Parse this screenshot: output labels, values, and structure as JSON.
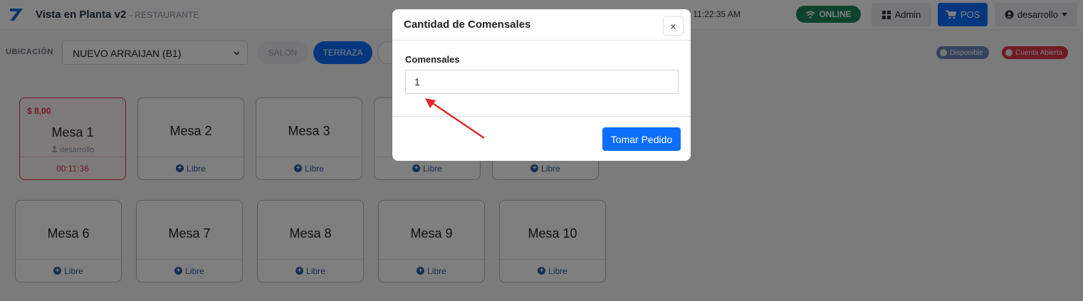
{
  "header": {
    "app_title": "Vista en Planta v2",
    "app_subtitle": "RESTAURANTE",
    "datetime": "/2026   11:22:35 AM",
    "online_label": "ONLINE",
    "admin_label": "Admin",
    "pos_label": "POS",
    "user_label": "desarrollo"
  },
  "toolbar": {
    "location_label": "UBICACIÓN",
    "location_value": "NUEVO ARRAIJAN (B1)",
    "areas": [
      "SALON",
      "TERRAZA"
    ],
    "legend_disponible": "Disponible",
    "legend_cuenta_abierta": "Cuenta Abierta"
  },
  "tables": [
    {
      "name": "Mesa 1",
      "amount": "$ 8,00",
      "user": "desarrollo",
      "status": "00:11:36",
      "open": true
    },
    {
      "name": "Mesa 2",
      "status": "Libre"
    },
    {
      "name": "Mesa 3",
      "status": "Libre"
    },
    {
      "name": "",
      "status": "Libre"
    },
    {
      "name": "",
      "status": "Libre"
    },
    {
      "name": "Mesa 6",
      "status": "Libre"
    },
    {
      "name": "Mesa 7",
      "status": "Libre"
    },
    {
      "name": "Mesa 8",
      "status": "Libre"
    },
    {
      "name": "Mesa 9",
      "status": "Libre"
    },
    {
      "name": "Mesa 10",
      "status": "Libre"
    }
  ],
  "modal": {
    "title": "Cantidad de Comensales",
    "close_glyph": "×",
    "field_label": "Comensales",
    "field_value": "1",
    "submit_label": "Tomar Pedido"
  },
  "colors": {
    "primary": "#0d6efd",
    "success": "#198754",
    "danger": "#dc3545",
    "annotation_arrow": "#e0262b"
  },
  "icons": [
    "logo-icon",
    "wifi-icon",
    "grid-icon",
    "cart-icon",
    "user-circle-icon",
    "caret-down-icon",
    "chevron-down-icon",
    "user-icon",
    "plus-circle-icon",
    "close-icon"
  ]
}
